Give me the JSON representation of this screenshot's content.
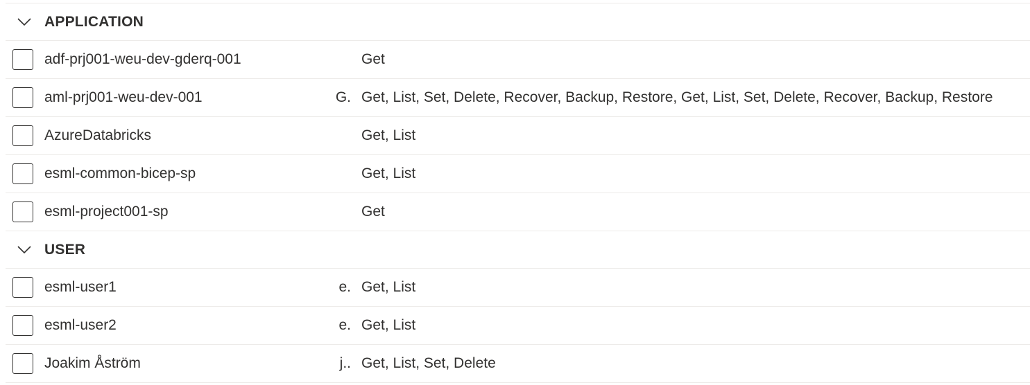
{
  "groups": [
    {
      "title": "APPLICATION",
      "rows": [
        {
          "name": "adf-prj001-weu-dev-gderq-001",
          "email": "",
          "permissions": "Get"
        },
        {
          "name": "aml-prj001-weu-dev-001",
          "email": "G.",
          "permissions": "Get, List, Set, Delete, Recover, Backup, Restore, Get, List, Set, Delete, Recover, Backup, Restore"
        },
        {
          "name": "AzureDatabricks",
          "email": "",
          "permissions": "Get, List"
        },
        {
          "name": "esml-common-bicep-sp",
          "email": "",
          "permissions": "Get, List"
        },
        {
          "name": "esml-project001-sp",
          "email": "",
          "permissions": "Get"
        }
      ]
    },
    {
      "title": "USER",
      "rows": [
        {
          "name": "esml-user1",
          "email": "e.",
          "permissions": "Get, List"
        },
        {
          "name": "esml-user2",
          "email": "e.",
          "permissions": "Get, List"
        },
        {
          "name": "Joakim Åström",
          "email": "j..",
          "permissions": "Get, List, Set, Delete"
        }
      ]
    }
  ],
  "icons": {
    "group_toggle": "chevron-down-icon",
    "row_select": "checkbox-icon"
  },
  "colors": {
    "text": "#323130",
    "divider": "#edebe9",
    "background": "#ffffff"
  }
}
